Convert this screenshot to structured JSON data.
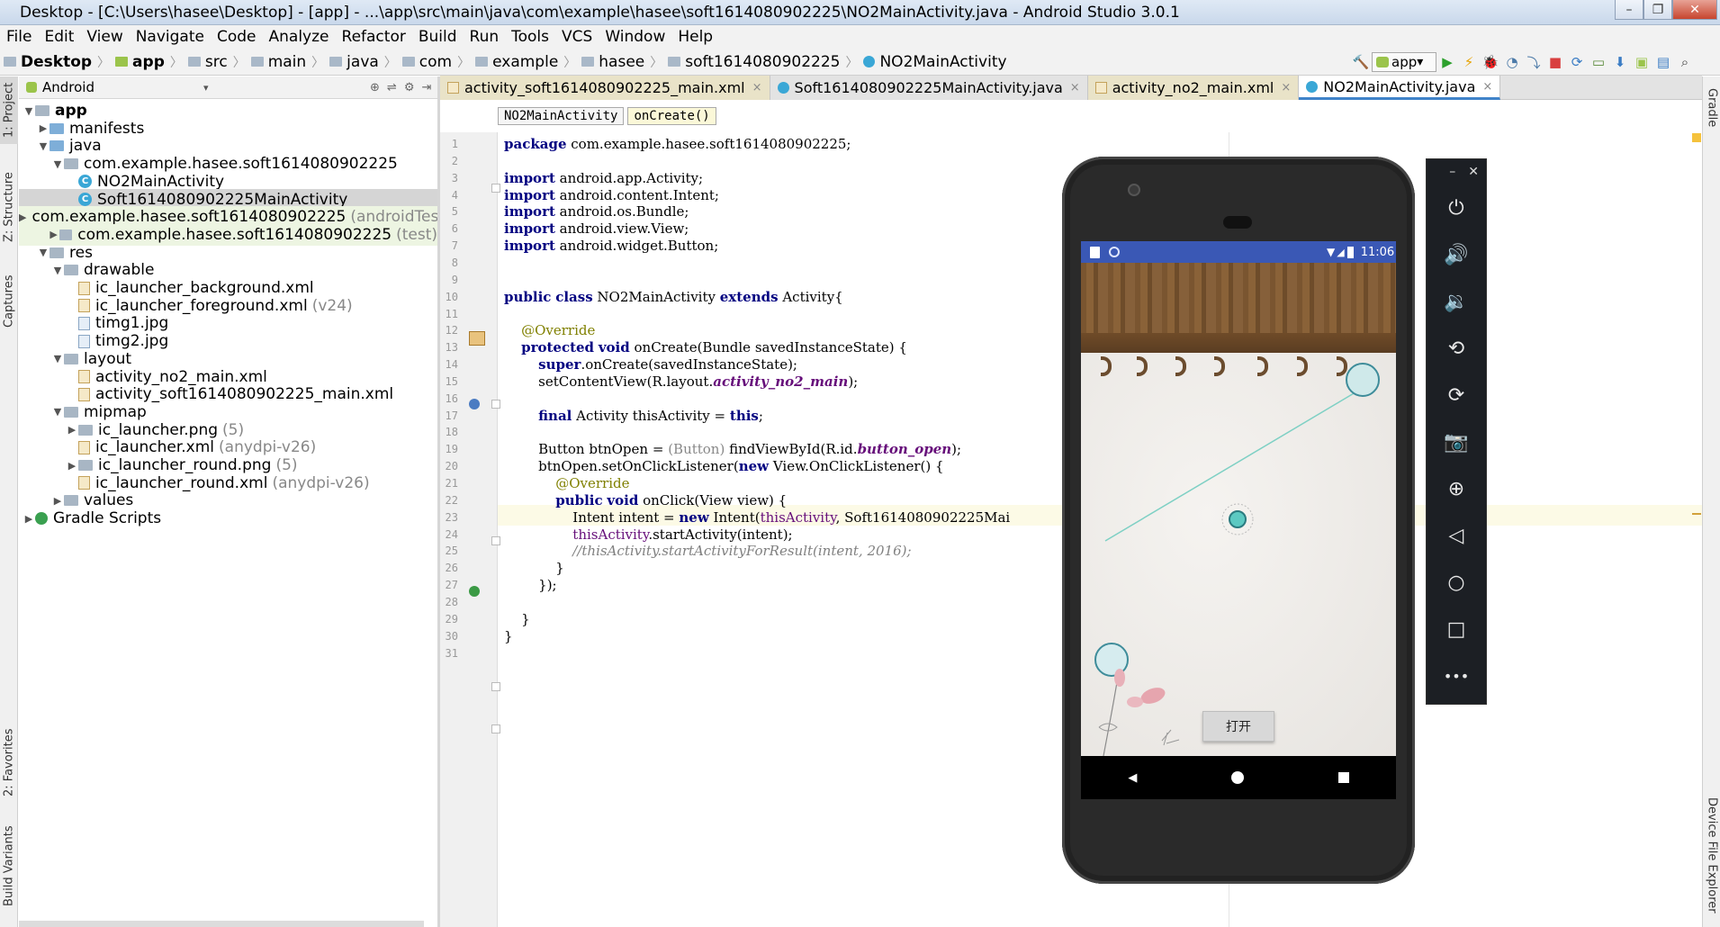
{
  "window": {
    "title": "Desktop - [C:\\Users\\hasee\\Desktop] - [app] - ...\\app\\src\\main\\java\\com\\example\\hasee\\soft1614080902225\\NO2MainActivity.java - Android Studio 3.0.1",
    "minimize": "–",
    "maximize": "❐",
    "close": "✕"
  },
  "menu": [
    "File",
    "Edit",
    "View",
    "Navigate",
    "Code",
    "Analyze",
    "Refactor",
    "Build",
    "Run",
    "Tools",
    "VCS",
    "Window",
    "Help"
  ],
  "breadcrumb": [
    "Desktop",
    "app",
    "src",
    "main",
    "java",
    "com",
    "example",
    "hasee",
    "soft1614080902225",
    "NO2MainActivity"
  ],
  "toolbar": {
    "run_config": "app"
  },
  "project_panel": {
    "view_mode": "Android"
  },
  "tree": [
    {
      "label": "app",
      "hint": "",
      "depth": 0,
      "arrow": "▼",
      "icon": "folder-gray",
      "bold": true,
      "row": "normal"
    },
    {
      "label": "manifests",
      "hint": "",
      "depth": 1,
      "arrow": "▶",
      "icon": "folder-blue",
      "bold": false,
      "row": "normal"
    },
    {
      "label": "java",
      "hint": "",
      "depth": 1,
      "arrow": "▼",
      "icon": "folder-blue",
      "bold": false,
      "row": "normal"
    },
    {
      "label": "com.example.hasee.soft1614080902225",
      "hint": "",
      "depth": 2,
      "arrow": "▼",
      "icon": "folder-gray",
      "bold": false,
      "row": "normal"
    },
    {
      "label": "NO2MainActivity",
      "hint": "",
      "depth": 3,
      "arrow": "",
      "icon": "class",
      "bold": false,
      "row": "normal"
    },
    {
      "label": "Soft1614080902225MainActivity",
      "hint": "",
      "depth": 3,
      "arrow": "",
      "icon": "class",
      "bold": false,
      "row": "selected"
    },
    {
      "label": "com.example.hasee.soft1614080902225",
      "hint": "(androidTest)",
      "depth": 2,
      "arrow": "▶",
      "icon": "folder-gray",
      "bold": false,
      "row": "green"
    },
    {
      "label": "com.example.hasee.soft1614080902225",
      "hint": "(test)",
      "depth": 2,
      "arrow": "▶",
      "icon": "folder-gray",
      "bold": false,
      "row": "green"
    },
    {
      "label": "res",
      "hint": "",
      "depth": 1,
      "arrow": "▼",
      "icon": "folder-gray",
      "bold": false,
      "row": "normal"
    },
    {
      "label": "drawable",
      "hint": "",
      "depth": 2,
      "arrow": "▼",
      "icon": "folder-gray",
      "bold": false,
      "row": "normal"
    },
    {
      "label": "ic_launcher_background.xml",
      "hint": "",
      "depth": 3,
      "arrow": "",
      "icon": "xml",
      "bold": false,
      "row": "normal"
    },
    {
      "label": "ic_launcher_foreground.xml",
      "hint": "(v24)",
      "depth": 3,
      "arrow": "",
      "icon": "xml",
      "bold": false,
      "row": "normal"
    },
    {
      "label": "timg1.jpg",
      "hint": "",
      "depth": 3,
      "arrow": "",
      "icon": "image",
      "bold": false,
      "row": "normal"
    },
    {
      "label": "timg2.jpg",
      "hint": "",
      "depth": 3,
      "arrow": "",
      "icon": "image",
      "bold": false,
      "row": "normal"
    },
    {
      "label": "layout",
      "hint": "",
      "depth": 2,
      "arrow": "▼",
      "icon": "folder-gray",
      "bold": false,
      "row": "normal"
    },
    {
      "label": "activity_no2_main.xml",
      "hint": "",
      "depth": 3,
      "arrow": "",
      "icon": "xml",
      "bold": false,
      "row": "normal"
    },
    {
      "label": "activity_soft1614080902225_main.xml",
      "hint": "",
      "depth": 3,
      "arrow": "",
      "icon": "xml",
      "bold": false,
      "row": "normal"
    },
    {
      "label": "mipmap",
      "hint": "",
      "depth": 2,
      "arrow": "▼",
      "icon": "folder-gray",
      "bold": false,
      "row": "normal"
    },
    {
      "label": "ic_launcher.png",
      "hint": "(5)",
      "depth": 3,
      "arrow": "▶",
      "icon": "folder-gray",
      "bold": false,
      "row": "normal"
    },
    {
      "label": "ic_launcher.xml",
      "hint": "(anydpi-v26)",
      "depth": 3,
      "arrow": "",
      "icon": "xml",
      "bold": false,
      "row": "normal"
    },
    {
      "label": "ic_launcher_round.png",
      "hint": "(5)",
      "depth": 3,
      "arrow": "▶",
      "icon": "folder-gray",
      "bold": false,
      "row": "normal"
    },
    {
      "label": "ic_launcher_round.xml",
      "hint": "(anydpi-v26)",
      "depth": 3,
      "arrow": "",
      "icon": "xml",
      "bold": false,
      "row": "normal"
    },
    {
      "label": "values",
      "hint": "",
      "depth": 2,
      "arrow": "▶",
      "icon": "folder-gray",
      "bold": false,
      "row": "normal"
    },
    {
      "label": "Gradle Scripts",
      "hint": "",
      "depth": 0,
      "arrow": "▶",
      "icon": "gradle",
      "bold": false,
      "row": "normal"
    }
  ],
  "editor_tabs": [
    {
      "label": "activity_soft1614080902225_main.xml",
      "kind": "xml",
      "active": false
    },
    {
      "label": "Soft1614080902225MainActivity.java",
      "kind": "java",
      "active": false
    },
    {
      "label": "activity_no2_main.xml",
      "kind": "xml",
      "active": false
    },
    {
      "label": "NO2MainActivity.java",
      "kind": "java",
      "active": true
    }
  ],
  "editor_breadcrumb": [
    "NO2MainActivity",
    "onCreate()"
  ],
  "code_lines": [
    "package com.example.hasee.soft1614080902225;",
    "",
    "import android.app.Activity;",
    "import android.content.Intent;",
    "import android.os.Bundle;",
    "import android.view.View;",
    "import android.widget.Button;",
    "",
    "",
    "public class NO2MainActivity extends Activity{",
    "",
    "    @Override",
    "    protected void onCreate(Bundle savedInstanceState) {",
    "        super.onCreate(savedInstanceState);",
    "        setContentView(R.layout.activity_no2_main);",
    "",
    "        final Activity thisActivity = this;",
    "",
    "        Button btnOpen = (Button) findViewById(R.id.button_open);",
    "        btnOpen.setOnClickListener(new View.OnClickListener() {",
    "            @Override",
    "            public void onClick(View view) {",
    "                Intent intent = new Intent(thisActivity, Soft1614080902225Mai",
    "                thisActivity.startActivity(intent);",
    "                //thisActivity.startActivityForResult(intent, 2016);",
    "            }",
    "        });",
    "",
    "    }",
    "}",
    ""
  ],
  "side_tabs": {
    "left": [
      "1: Project",
      "Z: Structure",
      "Captures",
      "2: Favorites",
      "Build Variants"
    ],
    "right": [
      "Gradle",
      "Device File Explorer"
    ]
  },
  "emulator": {
    "time": "11:06",
    "button_label": "打开",
    "controls": [
      "power-icon",
      "volume-up-icon",
      "volume-down-icon",
      "rotate-left-icon",
      "rotate-right-icon",
      "camera-icon",
      "zoom-icon",
      "back-icon",
      "home-icon",
      "overview-icon",
      "more-icon"
    ]
  }
}
